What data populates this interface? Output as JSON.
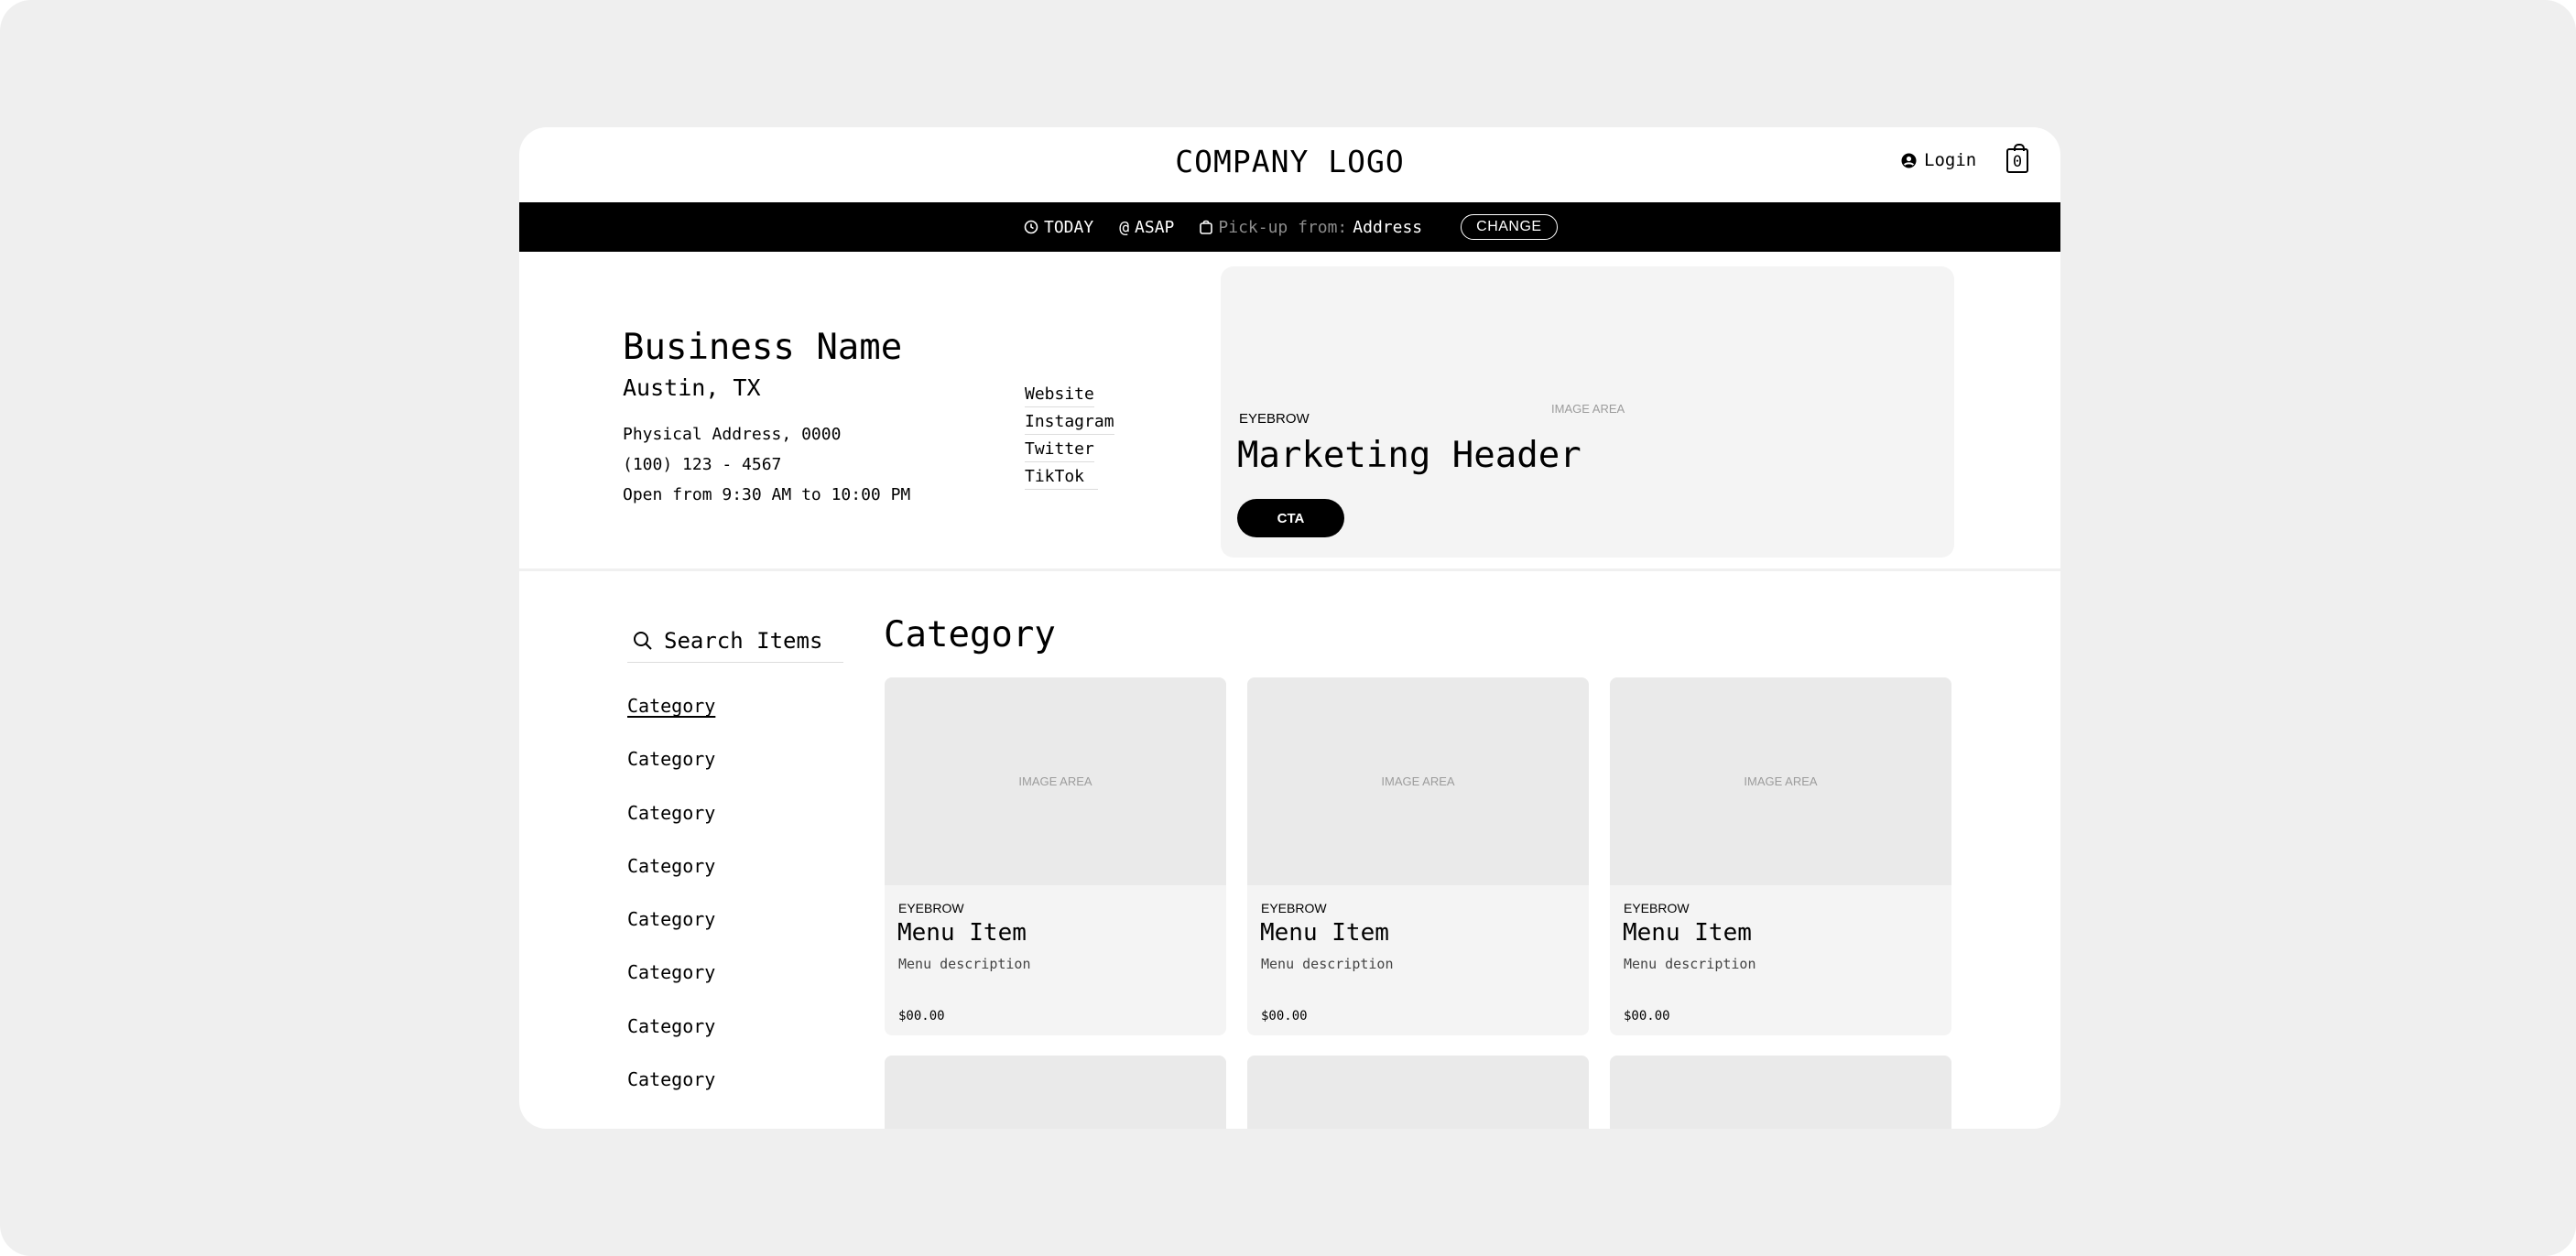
{
  "header": {
    "logo": "COMPANY LOGO",
    "login_label": "Login",
    "cart_count": "0"
  },
  "order_bar": {
    "day": "TODAY",
    "time": "ASAP",
    "pickup_prefix": "Pick-up from:",
    "pickup_address": "Address",
    "change_label": "CHANGE"
  },
  "business": {
    "name": "Business Name",
    "city": "Austin, TX",
    "address": "Physical Address, 0000",
    "phone": "(100) 123 - 4567",
    "hours": "Open from 9:30 AM to 10:00 PM",
    "links": [
      "Website",
      "Instagram",
      "Twitter",
      "TikTok"
    ]
  },
  "hero": {
    "image_label": "IMAGE AREA",
    "eyebrow": "EYEBROW",
    "title": "Marketing Header",
    "cta_label": "CTA"
  },
  "sidebar": {
    "search_placeholder": "Search Items",
    "categories": [
      "Category",
      "Category",
      "Category",
      "Category",
      "Category",
      "Category",
      "Category",
      "Category"
    ]
  },
  "main": {
    "category_title": "Category",
    "items": [
      {
        "image_label": "IMAGE AREA",
        "eyebrow": "EYEBROW",
        "title": "Menu Item",
        "description": "Menu description",
        "price": "$00.00"
      },
      {
        "image_label": "IMAGE AREA",
        "eyebrow": "EYEBROW",
        "title": "Menu Item",
        "description": "Menu description",
        "price": "$00.00"
      },
      {
        "image_label": "IMAGE AREA",
        "eyebrow": "EYEBROW",
        "title": "Menu Item",
        "description": "Menu description",
        "price": "$00.00"
      }
    ]
  },
  "colors": {
    "bar_background": "#000000",
    "page_background": "#efefef",
    "card_background": "#f4f4f4",
    "image_placeholder": "#eaeaea"
  }
}
